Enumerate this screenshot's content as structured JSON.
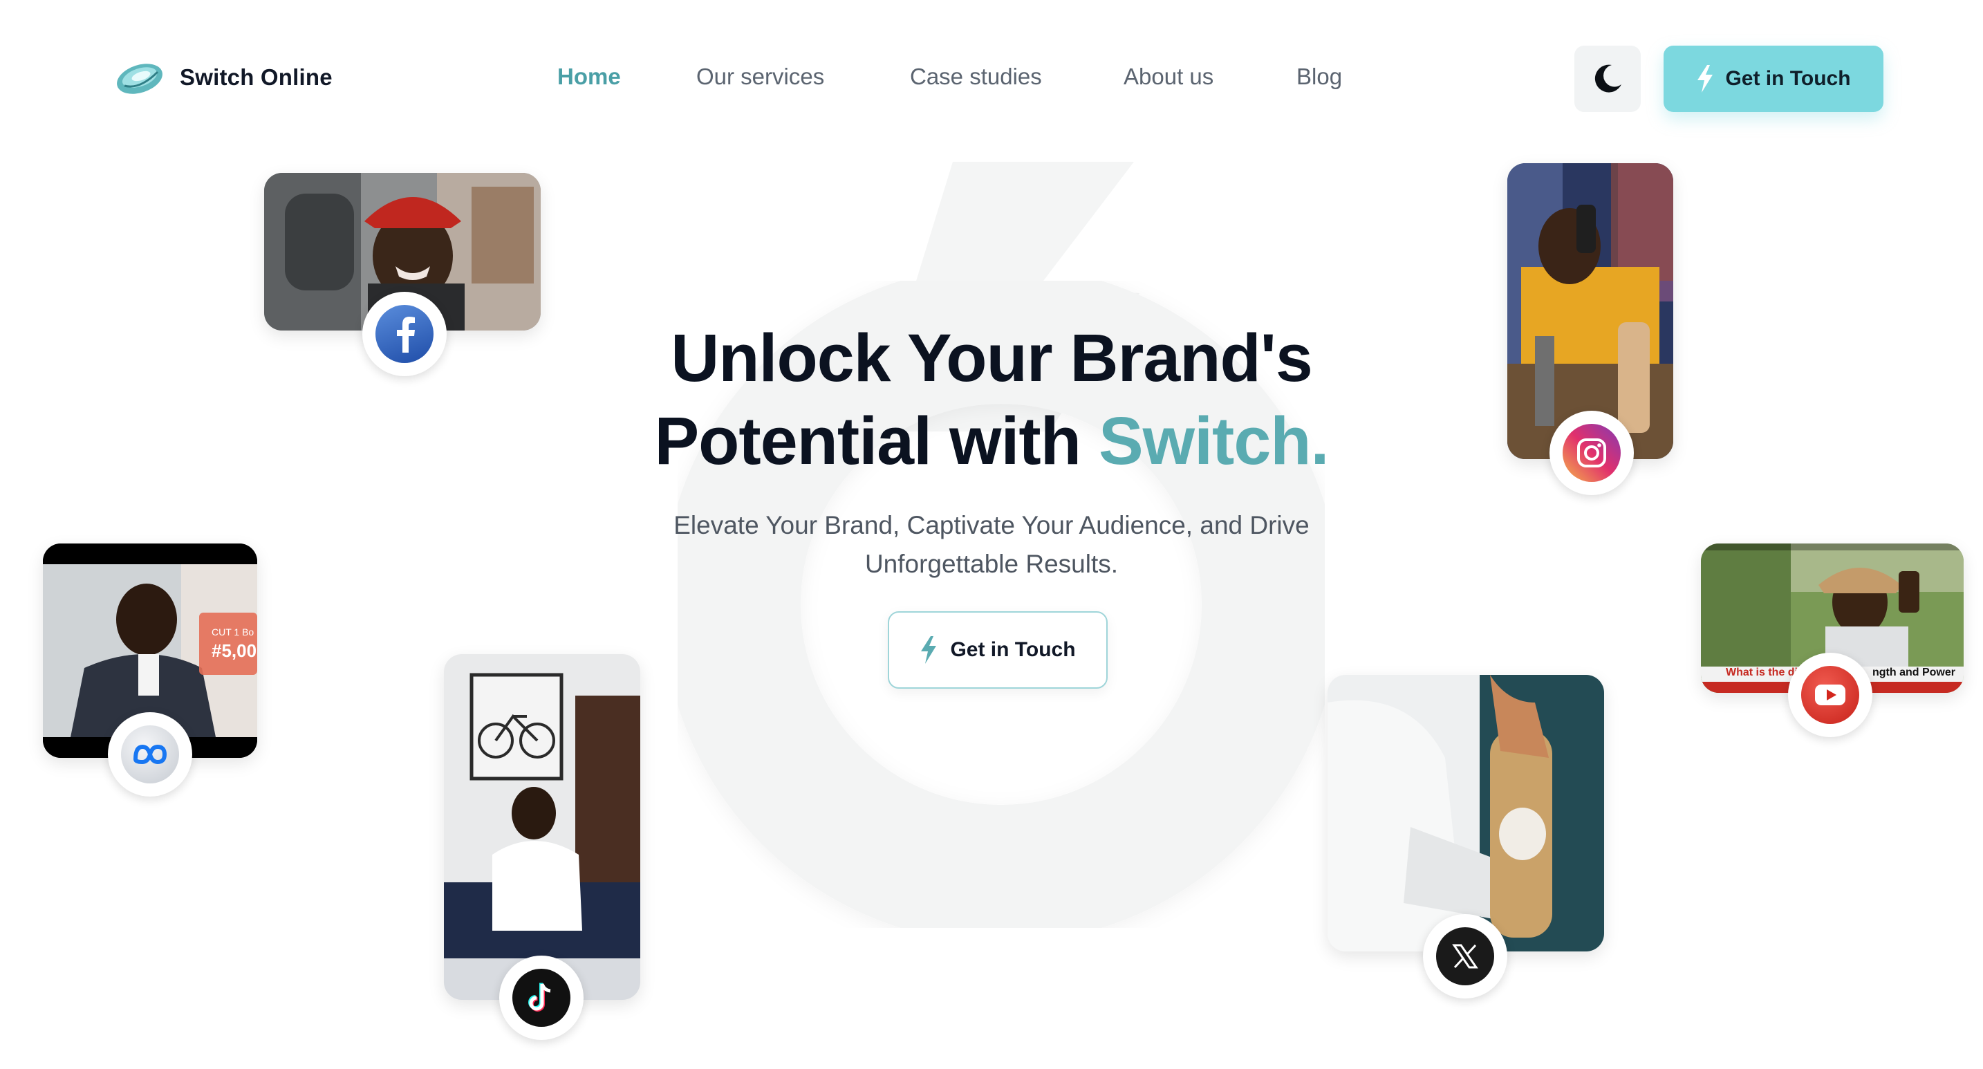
{
  "header": {
    "brand_name": "Switch Online",
    "nav": [
      {
        "label": "Home",
        "active": true
      },
      {
        "label": "Our services",
        "active": false
      },
      {
        "label": "Case studies",
        "active": false
      },
      {
        "label": "About us",
        "active": false
      },
      {
        "label": "Blog",
        "active": false
      }
    ],
    "theme_toggle_icon": "moon-icon",
    "cta_label": "Get in Touch"
  },
  "hero": {
    "title_line1": "Unlock Your Brand's",
    "title_line2_prefix": "Potential with ",
    "title_accent": "Switch",
    "title_dot": ".",
    "subtitle_line1": "Elevate Your Brand, Captivate Your Audience, and Drive",
    "subtitle_line2": "Unforgettable Results.",
    "cta_label": "Get in Touch"
  },
  "media_cards": [
    {
      "platform": "facebook",
      "icon": "facebook-icon"
    },
    {
      "platform": "instagram",
      "icon": "instagram-icon"
    },
    {
      "platform": "meta",
      "icon": "meta-icon",
      "overlay_text_1": "CUT 1 Bo",
      "overlay_text_2": "#5,00"
    },
    {
      "platform": "youtube",
      "icon": "youtube-icon",
      "caption_left": "What is the diffe",
      "caption_right": "ngth and Power"
    },
    {
      "platform": "tiktok",
      "icon": "tiktok-icon"
    },
    {
      "platform": "x",
      "icon": "x-icon"
    }
  ],
  "colors": {
    "accent": "#5aabb1",
    "cta_background": "#7cd8df",
    "nav_active": "#4a9fa6",
    "title": "#0b1220"
  }
}
